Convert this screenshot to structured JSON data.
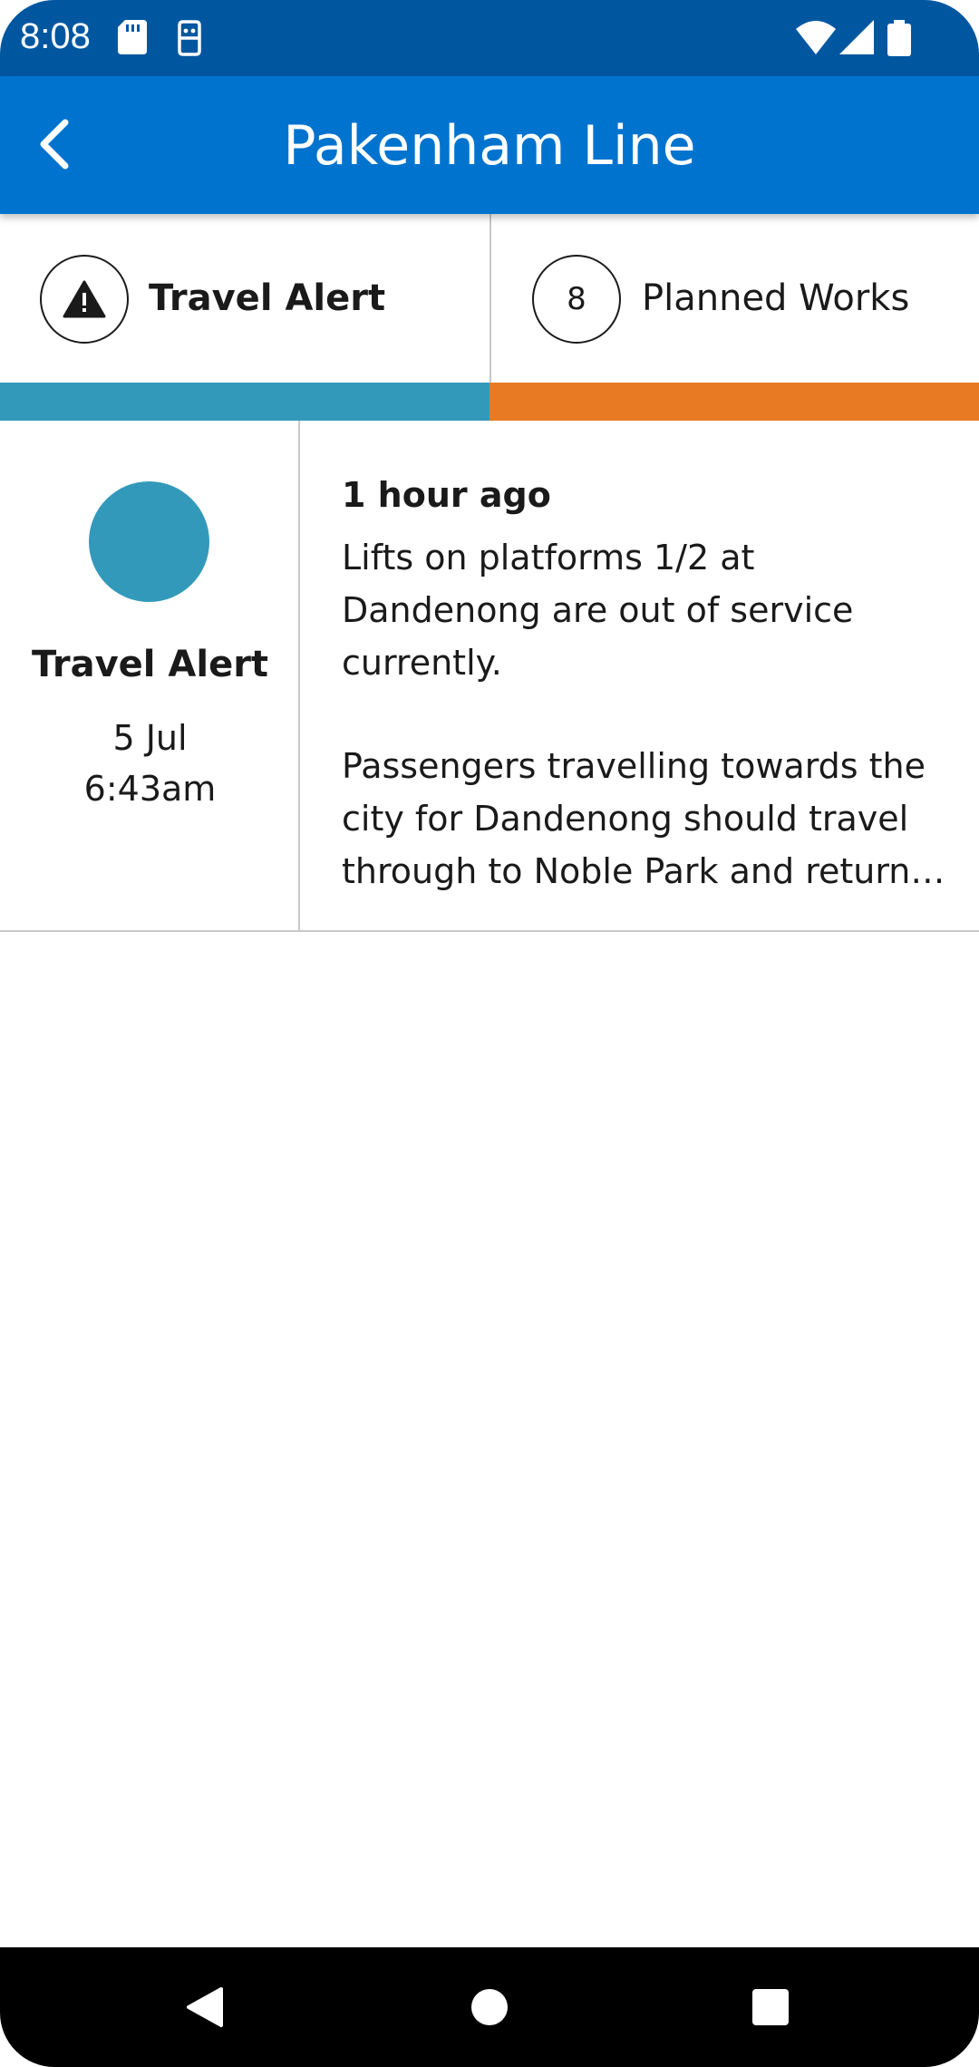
{
  "status_bar": {
    "time": "8:08"
  },
  "app_bar": {
    "title": "Pakenham Line"
  },
  "tabs": [
    {
      "label": "Travel Alert",
      "icon": "warning-icon",
      "color": "#3399bb"
    },
    {
      "label": "Planned Works",
      "count": "8",
      "color": "#e77a22"
    }
  ],
  "alert": {
    "type": "Travel Alert",
    "date": "5 Jul",
    "time": "6:43am",
    "relative_time": "1 hour ago",
    "body_1": "Lifts on platforms 1/2 at Dandenong are out of service currently.",
    "body_2": "Passengers travelling towards the city for Dandenong should travel through to Noble Park and return to Dandenong."
  },
  "colors": {
    "status_bar": "#0057a0",
    "app_bar": "#0073cf",
    "travel_alert": "#3399bb",
    "planned_works": "#e77a22"
  }
}
